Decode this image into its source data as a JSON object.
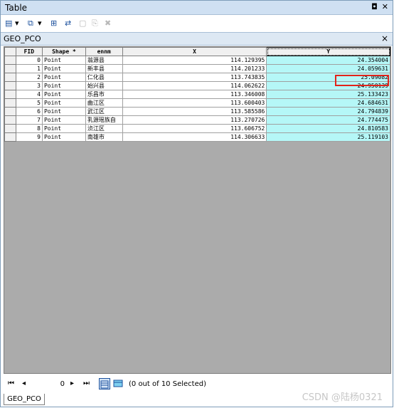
{
  "window": {
    "title": "Table",
    "pin_glyph": "◘",
    "close_glyph": "✕"
  },
  "toolbar": {
    "items": [
      {
        "icon": "table-options-icon",
        "glyph": "▤",
        "state": "enabled"
      },
      {
        "icon": "dropdown-arrow-icon",
        "glyph": "▾",
        "state": "enabled"
      },
      {
        "icon": "related-tables-icon",
        "glyph": "⧉",
        "state": "enabled"
      },
      {
        "icon": "dropdown-arrow-icon",
        "glyph": "▾",
        "state": "enabled"
      },
      {
        "icon": "select-by-attributes-icon",
        "glyph": "⊞",
        "state": "enabled"
      },
      {
        "icon": "switch-selection-icon",
        "glyph": "⇄",
        "state": "enabled"
      },
      {
        "icon": "clear-selection-icon",
        "glyph": "▢",
        "state": "disabled"
      },
      {
        "icon": "zoom-to-selected-icon",
        "glyph": "⎘",
        "state": "disabled"
      },
      {
        "icon": "delete-selected-icon",
        "glyph": "✖",
        "state": "disabled"
      }
    ]
  },
  "tab": {
    "label": "GEO_PCO",
    "close_glyph": "×"
  },
  "grid": {
    "columns": [
      "FID",
      "Shape *",
      "ennm",
      "X",
      "Y"
    ],
    "rows": [
      [
        "0",
        "Point",
        "翁源县",
        "114.129395",
        "24.354004"
      ],
      [
        "1",
        "Point",
        "新丰县",
        "114.201233",
        "24.059631"
      ],
      [
        "2",
        "Point",
        "仁化县",
        "113.743835",
        "25.09082"
      ],
      [
        "3",
        "Point",
        "始兴县",
        "114.062622",
        "24.950139"
      ],
      [
        "4",
        "Point",
        "乐昌市",
        "113.346008",
        "25.133423"
      ],
      [
        "5",
        "Point",
        "曲江区",
        "113.600403",
        "24.684631"
      ],
      [
        "6",
        "Point",
        "武江区",
        "113.585586",
        "24.794839"
      ],
      [
        "7",
        "Point",
        "乳源瑶族自",
        "113.270726",
        "24.774475"
      ],
      [
        "8",
        "Point",
        "浈江区",
        "113.606752",
        "24.810583"
      ],
      [
        "9",
        "Point",
        "南雄市",
        "114.306633",
        "25.119103"
      ]
    ]
  },
  "nav": {
    "first_glyph": "⏮",
    "prev_glyph": "◂",
    "record": "0",
    "next_glyph": "▸",
    "last_glyph": "⏭",
    "selection_text": "(0 out of 10 Selected)"
  },
  "bottom_tab": {
    "label": "GEO_PCO"
  },
  "watermark": "CSDN @陆杨0321",
  "colors": {
    "selected_column": "#b5f7f7",
    "highlight_box": "#e2231a"
  }
}
